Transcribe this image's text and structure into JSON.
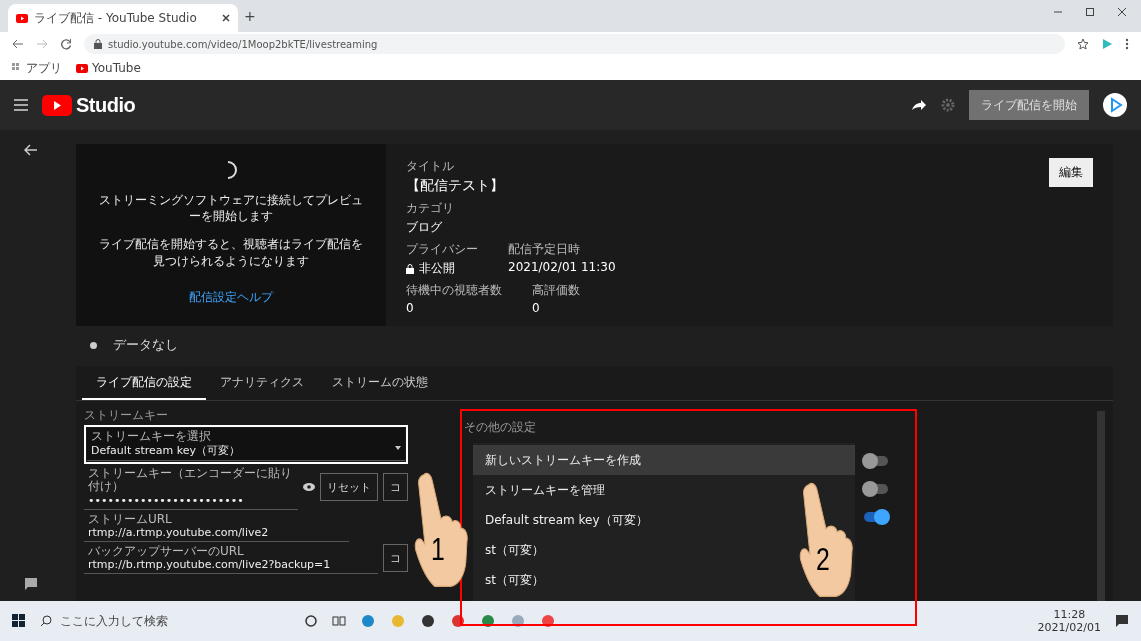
{
  "browser": {
    "tabs": [
      {
        "title": "ライブ配信 - YouTube Studio",
        "selected": true
      }
    ],
    "new_tab": "+",
    "url": "studio.youtube.com/video/1Moop2bkTE/livestreaming",
    "bookmarks": [
      "アプリ",
      "YouTube"
    ]
  },
  "header": {
    "logo": "Studio",
    "go_live_button": "ライブ配信を開始"
  },
  "preview": {
    "message": "ストリーミングソフトウェアに接続してプレビューを開始します",
    "note": "ライブ配信を開始すると、視聴者はライブ配信を見つけられるようになります",
    "help_link": "配信設定ヘルプ"
  },
  "details": {
    "edit_button": "編集",
    "rows": [
      [
        {
          "label": "タイトル",
          "value": "【配信テスト】",
          "kind": "text"
        }
      ],
      [
        {
          "label": "カテゴリ",
          "value": "ブログ",
          "kind": "text"
        }
      ],
      [
        {
          "label": "プライバシー",
          "value": "非公開",
          "kind": "private"
        },
        {
          "label": "配信予定日時",
          "value": "2021/02/01 11:30",
          "kind": "text"
        }
      ],
      [
        {
          "label": "待機中の視聴者数",
          "value": "0",
          "kind": "text"
        },
        {
          "label": "高評価数",
          "value": "0",
          "kind": "text"
        }
      ]
    ]
  },
  "status": {
    "text": "データなし"
  },
  "tabs": [
    {
      "label": "ライブ配信の設定",
      "selected": true
    },
    {
      "label": "アナリティクス",
      "selected": false
    },
    {
      "label": "ストリームの状態",
      "selected": false
    }
  ],
  "stream_key": {
    "section_title": "ストリームキー",
    "select": {
      "label": "ストリームキーを選択",
      "value": "Default stream key（可変）"
    },
    "key_field": {
      "label": "ストリームキー（エンコーダーに貼り付け）",
      "value": "••••••••••••••••••••••••"
    },
    "reset_button": "リセット",
    "copy_button": "コ",
    "url_field": {
      "label": "ストリームURL",
      "value": "rtmp://a.rtmp.youtube.com/live2"
    },
    "backup_field": {
      "label": "バックアップサーバーのURL",
      "value": "rtmp://b.rtmp.youtube.com/live2?backup=1"
    },
    "backup_copy_button": "コ"
  },
  "other_settings": {
    "title": "その他の設定",
    "toggles": [
      {
        "on": false
      },
      {
        "on": false
      },
      {
        "on": true
      }
    ]
  },
  "dropdown_menu": {
    "items": [
      {
        "label": "新しいストリームキーを作成",
        "highlighted": true
      },
      {
        "label": "ストリームキーを管理",
        "highlighted": false
      },
      {
        "label": "Default stream key（可変）",
        "highlighted": false
      },
      {
        "label": "st（可変）",
        "highlighted": false
      },
      {
        "label": "st（可変）",
        "highlighted": false
      }
    ]
  },
  "taskbar": {
    "search_placeholder": "ここに入力して検索",
    "time": "11:28",
    "date": "2021/02/01"
  },
  "annotations": [
    {
      "kind": "frame",
      "color": "#ffffff"
    },
    {
      "kind": "frame",
      "color": "#ff0000"
    },
    {
      "kind": "hand",
      "number": "1"
    },
    {
      "kind": "hand",
      "number": "2"
    }
  ]
}
